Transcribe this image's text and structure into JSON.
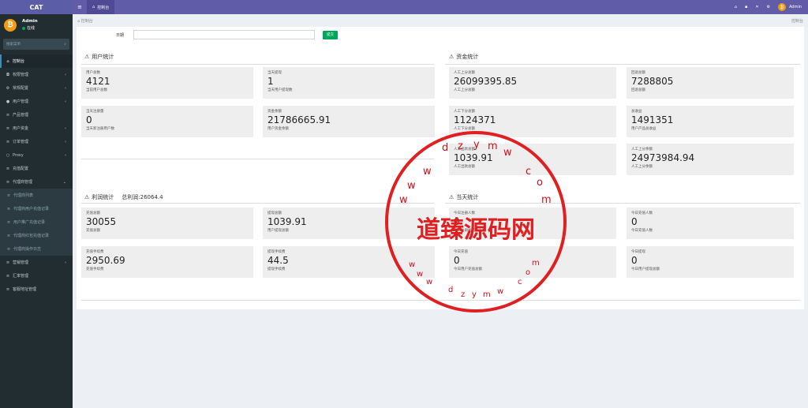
{
  "app": {
    "logo": "CAT"
  },
  "user": {
    "name": "Admin",
    "status": "在线",
    "avatar_glyph": "₿"
  },
  "search": {
    "placeholder": "搜索菜单"
  },
  "sidebar": {
    "items": [
      {
        "label": "控制台",
        "icon": "dashboard-icon",
        "active": true,
        "caret": false
      },
      {
        "label": "权限管理",
        "icon": "shield-icon",
        "caret": true
      },
      {
        "label": "常规配置",
        "icon": "cog-icon",
        "caret": true
      },
      {
        "label": "用户管理",
        "icon": "user-icon",
        "caret": true
      },
      {
        "label": "产品管理",
        "icon": "list-icon",
        "caret": false
      },
      {
        "label": "用户资金",
        "icon": "list-icon",
        "caret": true
      },
      {
        "label": "订单管理",
        "icon": "list-icon",
        "caret": true
      },
      {
        "label": "Proxy",
        "icon": "circle-icon",
        "caret": true
      },
      {
        "label": "充值配置",
        "icon": "list-icon",
        "caret": false
      },
      {
        "label": "代理商管理",
        "icon": "list-icon",
        "caret": true,
        "open": true
      },
      {
        "label": "代理商列表",
        "icon": "list-icon",
        "sub": true
      },
      {
        "label": "代理商用户充值记录",
        "icon": "list-icon",
        "sub": true
      },
      {
        "label": "用户推广充值记录",
        "icon": "list-icon",
        "sub": true
      },
      {
        "label": "代理商红包充值记录",
        "icon": "list-icon",
        "sub": true
      },
      {
        "label": "代理商操作日志",
        "icon": "list-icon",
        "sub": true
      },
      {
        "label": "营销管理",
        "icon": "list-icon",
        "caret": true
      },
      {
        "label": "汇率管理",
        "icon": "list-icon",
        "caret": false
      },
      {
        "label": "客服地址管理",
        "icon": "list-icon",
        "caret": false
      }
    ]
  },
  "header": {
    "tab_label": "控制台",
    "right_user": "Admin"
  },
  "breadcrumb": {
    "left": "控制台",
    "right": "控制台"
  },
  "filter": {
    "date_label": "日期",
    "submit_label": "提交"
  },
  "sections": {
    "users": {
      "title": "用户统计",
      "stats": [
        {
          "label": "用户总数",
          "value": "4121",
          "desc": "当前用户总数"
        },
        {
          "label": "当天提现",
          "value": "1",
          "desc": "当天用户提现数"
        },
        {
          "label": "当天注册量",
          "value": "0",
          "desc": "当天新注册用户数"
        },
        {
          "label": "资金余额",
          "value": "21786665.91",
          "desc": "用户资金余额"
        }
      ]
    },
    "funds": {
      "title": "资金统计",
      "stats": [
        {
          "label": "人工上分总额",
          "value": "26099395.85",
          "desc": "人工上分总额"
        },
        {
          "label": "回退总额",
          "value": "7288805",
          "desc": "回退总额"
        },
        {
          "label": "人工下分总额",
          "value": "1124371",
          "desc": "人工下分总额"
        },
        {
          "label": "总收益",
          "value": "1491351",
          "desc": "用户产品总收益"
        },
        {
          "label": "人工出款总额",
          "value": "1039.91",
          "desc": "人工出款总额"
        },
        {
          "label": "人工上分余额",
          "value": "24973984.94",
          "desc": "人工上分余额"
        }
      ]
    },
    "profit": {
      "title": "利润统计",
      "extra": "总利润:26064.4",
      "stats": [
        {
          "label": "充值总额",
          "value": "30055",
          "desc": "充值总额"
        },
        {
          "label": "提现总额",
          "value": "1039.91",
          "desc": "用户提现总额"
        },
        {
          "label": "充值手续费",
          "value": "2950.69",
          "desc": "充值手续费"
        },
        {
          "label": "提现手续费",
          "value": "44.5",
          "desc": "提现手续费"
        }
      ]
    },
    "today": {
      "title": "当天统计",
      "stats": [
        {
          "label": "今日注册人数",
          "value": "0",
          "desc": "今日注册并充值人数"
        },
        {
          "label": "今日充值人数",
          "value": "0",
          "desc": "今日充值人数"
        },
        {
          "label": "今日充值",
          "value": "0",
          "desc": "今日用户充值总额"
        },
        {
          "label": "今日提现",
          "value": "0",
          "desc": "今日用户提现总额"
        }
      ]
    }
  },
  "watermark": {
    "title": "道臻源码网",
    "ring_color": "#e02020"
  },
  "colors": {
    "header": "#605ca8",
    "sidebar": "#222d32",
    "submit": "#00a65a",
    "tile": "#eeeeee"
  }
}
